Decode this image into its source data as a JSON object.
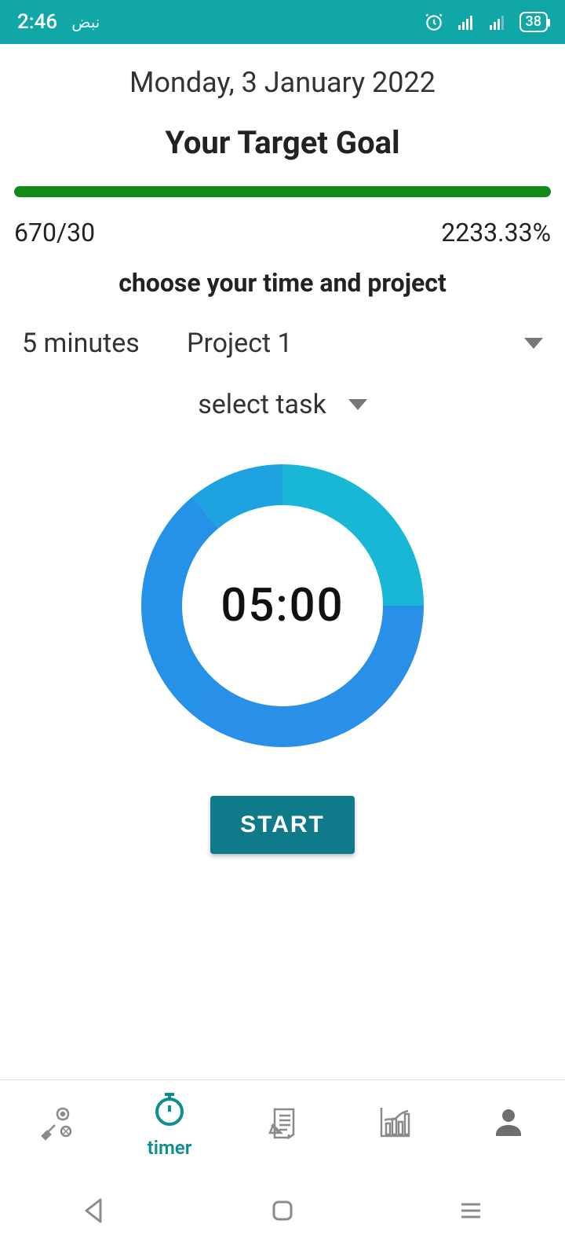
{
  "status": {
    "time": "2:46",
    "arabic": "نبض",
    "battery": "38"
  },
  "header": {
    "date": "Monday, 3 January 2022",
    "title": "Your Target Goal"
  },
  "goal": {
    "ratio": "670/30",
    "percent": "2233.33%"
  },
  "picker": {
    "subtitle": "choose your time and project",
    "time": "5 minutes",
    "project": "Project 1",
    "task": "select task"
  },
  "timer": {
    "display": "05:00",
    "start_label": "START"
  },
  "nav": {
    "timer_label": "timer"
  }
}
